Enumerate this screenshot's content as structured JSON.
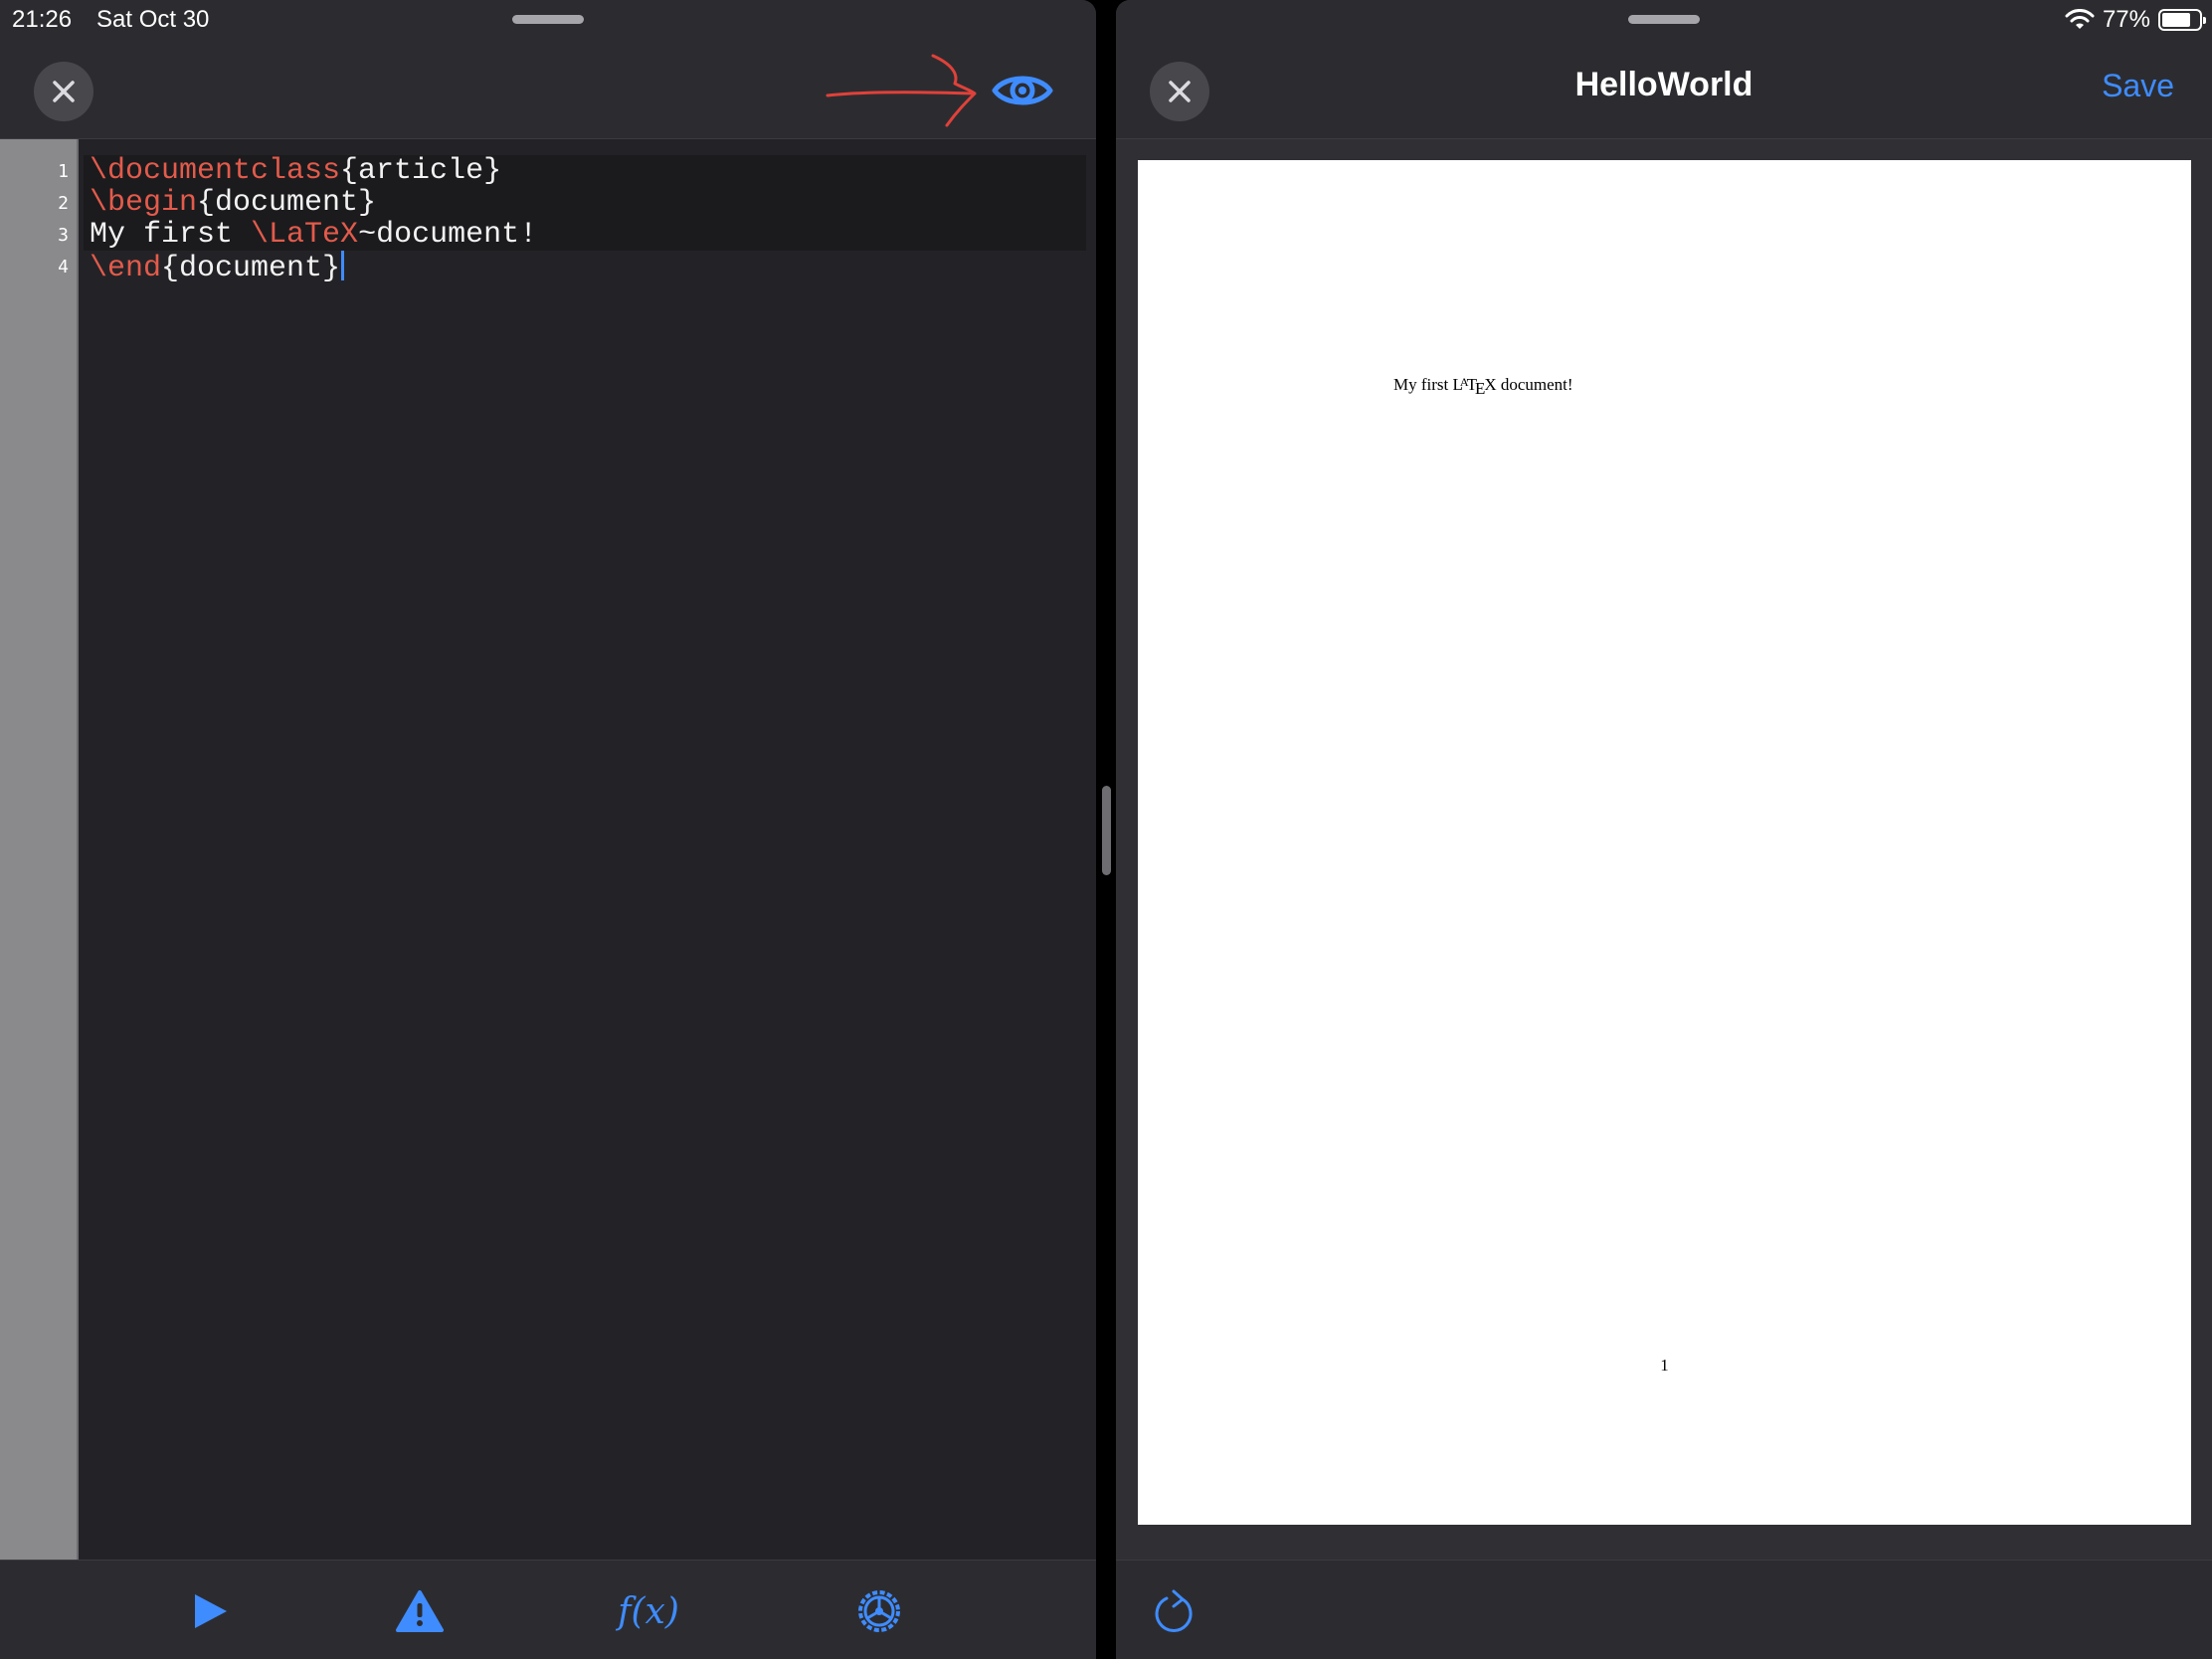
{
  "status_bar": {
    "time": "21:26",
    "date": "Sat Oct 30",
    "battery_text": "77%",
    "battery_level": 0.77
  },
  "editor": {
    "line_numbers": [
      "1",
      "2",
      "3",
      "4"
    ],
    "lines": [
      [
        {
          "t": "\\documentclass",
          "cmd": true
        },
        {
          "t": "{article}",
          "cmd": false
        }
      ],
      [
        {
          "t": "\\begin",
          "cmd": true
        },
        {
          "t": "{document}",
          "cmd": false
        }
      ],
      [
        {
          "t": "My first ",
          "cmd": false
        },
        {
          "t": "\\LaTeX",
          "cmd": true
        },
        {
          "t": "~document!",
          "cmd": false
        }
      ],
      [
        {
          "t": "\\end",
          "cmd": true
        },
        {
          "t": "{document}",
          "cmd": false
        }
      ]
    ]
  },
  "preview": {
    "title": "HelloWorld",
    "save_label": "Save",
    "page_text": "My first LaTeX document!",
    "page_number": "1"
  },
  "toolbar": {
    "fx_label": "f(x)"
  },
  "colors": {
    "accent": "#3f8cff",
    "command": "#e35b4b",
    "annotation": "#e0413a"
  }
}
